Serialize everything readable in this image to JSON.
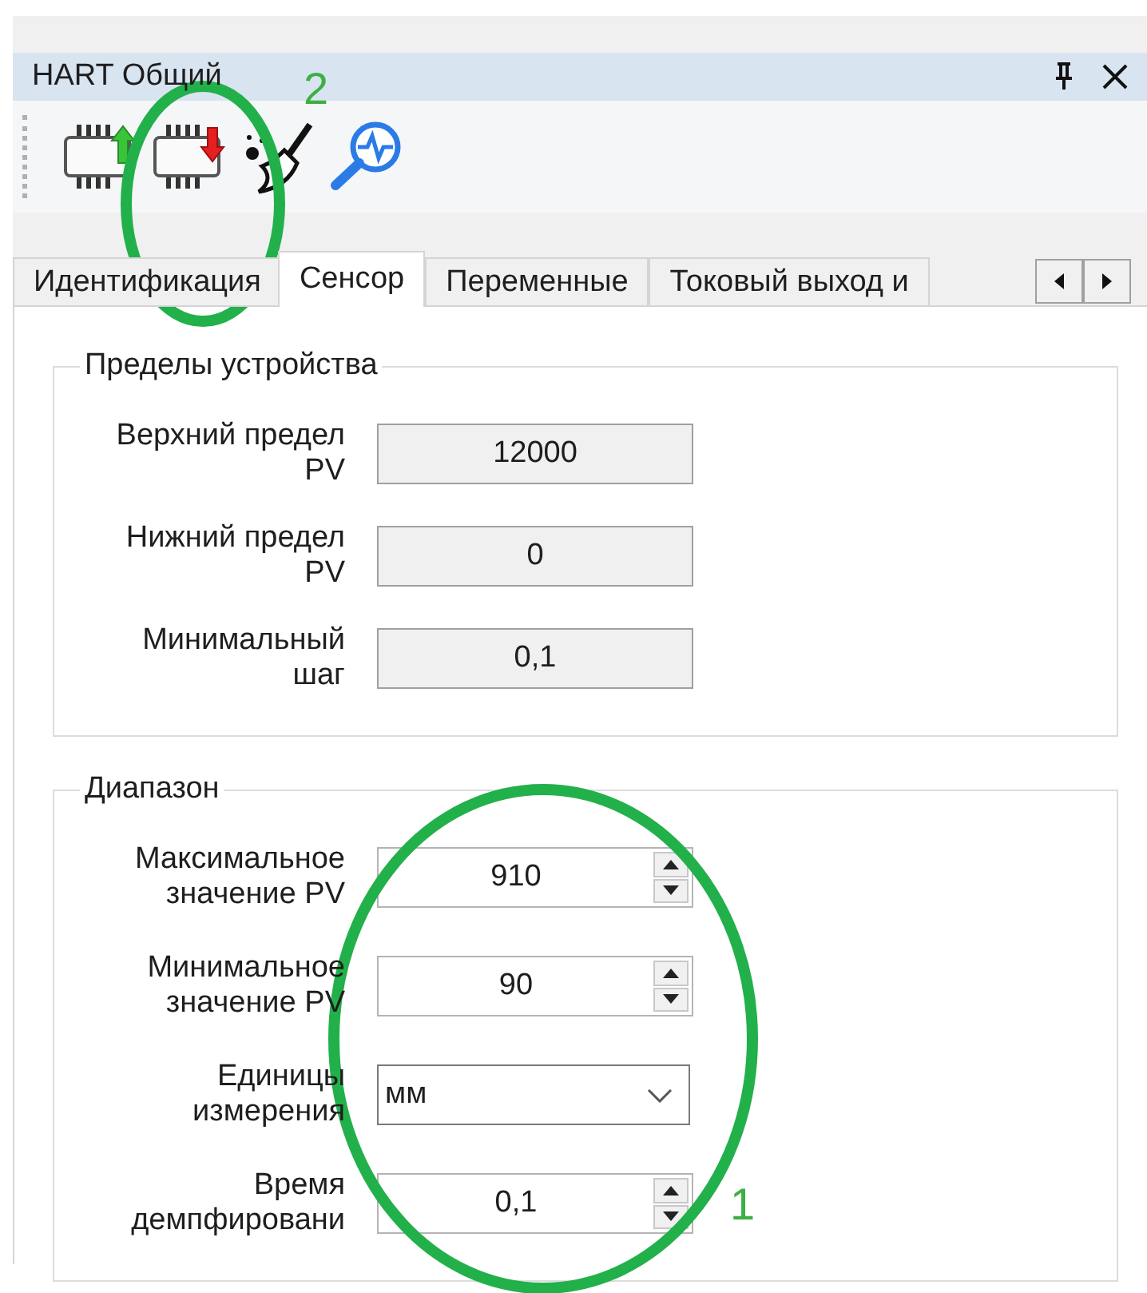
{
  "window": {
    "title": "HART Общий"
  },
  "toolbar": [
    {
      "kind": "upload"
    },
    {
      "kind": "download"
    },
    {
      "kind": "clear"
    },
    {
      "kind": "diagnose"
    }
  ],
  "tabs": [
    {
      "label": "Идентификация",
      "selected": false
    },
    {
      "label": "Сенсор",
      "selected": true
    },
    {
      "label": "Переменные",
      "selected": false
    },
    {
      "label": "Токовый выход и",
      "selected": false
    }
  ],
  "groups": [
    {
      "title": "Пределы устройства",
      "fields": [
        {
          "kind": "readonly",
          "label": "Верхний предел\nPV",
          "value": "12000"
        },
        {
          "kind": "readonly",
          "label": "Нижний предел\nPV",
          "value": "0"
        },
        {
          "kind": "readonly",
          "label": "Минимальный\nшаг",
          "value": "0,1"
        }
      ]
    },
    {
      "title": "Диапазон",
      "fields": [
        {
          "kind": "spin",
          "label": "Максимальное\nзначение PV",
          "value": "910"
        },
        {
          "kind": "spin",
          "label": "Минимальное\nзначение PV",
          "value": "90"
        },
        {
          "kind": "combo",
          "label": "Единицы\nизмерения",
          "value": "мм"
        },
        {
          "kind": "spin",
          "label": "Время\nдемпфировани",
          "value": "0,1"
        }
      ]
    }
  ],
  "annotations": [
    {
      "number": "2"
    },
    {
      "number": "1"
    }
  ]
}
